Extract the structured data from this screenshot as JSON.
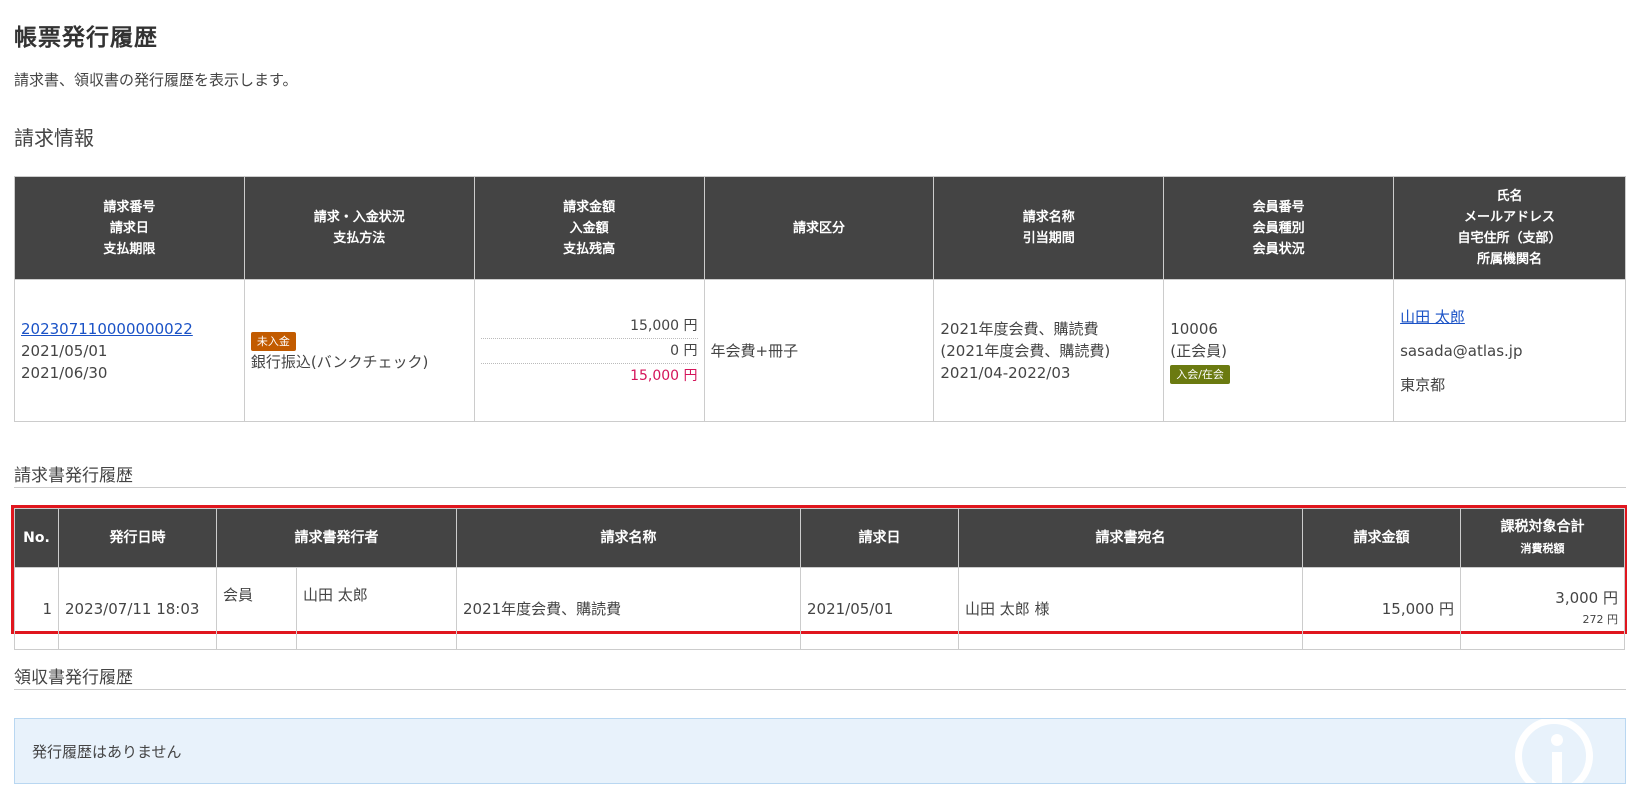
{
  "title": "帳票発行履歴",
  "description": "請求書、領収書の発行履歴を表示します。",
  "billing_section_title": "請求情報",
  "billing_table": {
    "headers": [
      [
        "請求番号",
        "請求日",
        "支払期限"
      ],
      [
        "請求・入金状況",
        "支払方法"
      ],
      [
        "請求金額",
        "入金額",
        "支払残高"
      ],
      [
        "請求区分"
      ],
      [
        "請求名称",
        "引当期間"
      ],
      [
        "会員番号",
        "会員種別",
        "会員状況"
      ],
      [
        "氏名",
        "メールアドレス",
        "自宅住所（支部）",
        "所属機関名"
      ]
    ],
    "row": {
      "invoice_no": "202307110000000022",
      "invoice_date": "2021/05/01",
      "due_date": "2021/06/30",
      "status_badge": "未入金",
      "status_badge_color": "#c25b00",
      "payment_method": "銀行振込(バンクチェック)",
      "billed_amount": "15,000 円",
      "paid_amount": "0 円",
      "balance": "15,000 円",
      "balance_color": "#d4145a",
      "category": "年会費+冊子",
      "billing_name": "2021年度会費、購読費",
      "billing_name_paren": "(2021年度会費、購読費)",
      "period": "2021/04-2022/03",
      "member_no": "10006",
      "member_type": "(正会員)",
      "member_status_badge": "入会/在会",
      "member_status_badge_color": "#6b7a10",
      "name": "山田 太郎",
      "email": "sasada@atlas.jp",
      "address": "東京都"
    }
  },
  "invoice_history_title": "請求書発行履歴",
  "invoice_history_table": {
    "headers": {
      "no": "No.",
      "issued_at": "発行日時",
      "issuer": "請求書発行者",
      "billing_name": "請求名称",
      "invoice_date": "請求日",
      "addressee": "請求書宛名",
      "amount": "請求金額",
      "taxable_total": "課税対象合計",
      "tax": "消費税額"
    },
    "rows": [
      {
        "no": "1",
        "issued_at": "2023/07/11 18:03",
        "issuer_type": "会員",
        "issuer_name": "山田 太郎",
        "billing_name": "2021年度会費、購読費",
        "invoice_date": "2021/05/01",
        "addressee": "山田 太郎 様",
        "amount": "15,000 円",
        "taxable_total": "3,000 円",
        "tax": "272 円"
      }
    ]
  },
  "highlight_color": "#e0161e",
  "receipt_history_title": "領収書発行履歴",
  "receipt_history_empty": "発行履歴はありません",
  "receipt_notice_icon": "info-icon"
}
